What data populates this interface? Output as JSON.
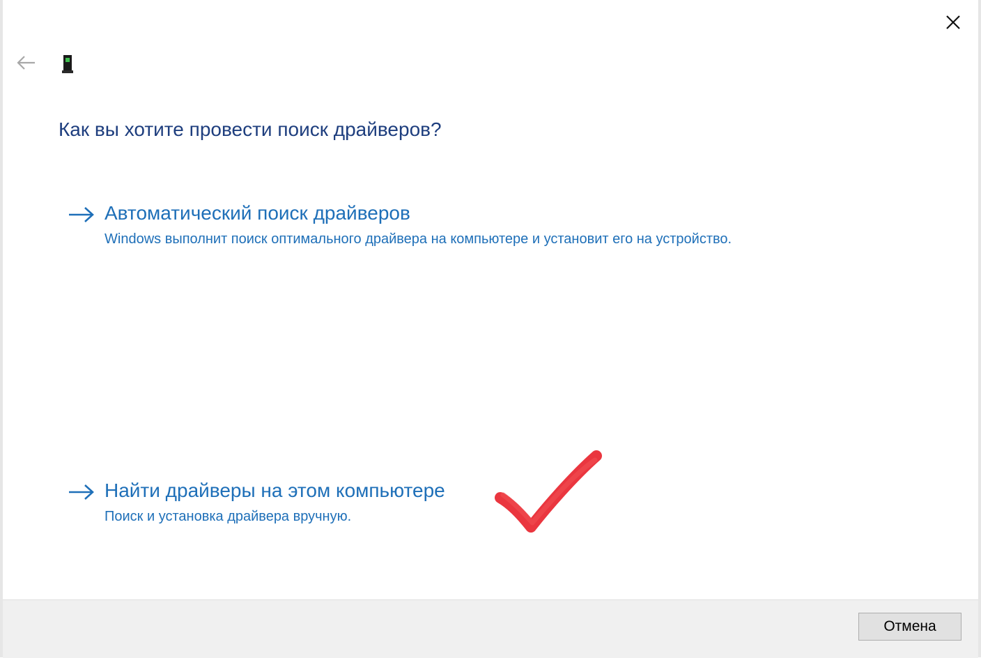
{
  "dialog": {
    "question": "Как вы хотите провести поиск драйверов?",
    "options": [
      {
        "title": "Автоматический поиск драйверов",
        "description": "Windows выполнит поиск оптимального драйвера на компьютере и установит его на устройство."
      },
      {
        "title": "Найти драйверы на этом компьютере",
        "description": "Поиск и установка драйвера вручную."
      }
    ],
    "cancel_label": "Отмена"
  },
  "icons": {
    "close": "close-icon",
    "back": "back-arrow-icon",
    "device": "device-icon",
    "option_arrow": "arrow-right-icon",
    "annotation": "red-checkmark-icon"
  },
  "colors": {
    "heading": "#1e3e7e",
    "link": "#1e6fb8",
    "footer_bg": "#f0f0f0",
    "checkmark": "#e8202a"
  }
}
